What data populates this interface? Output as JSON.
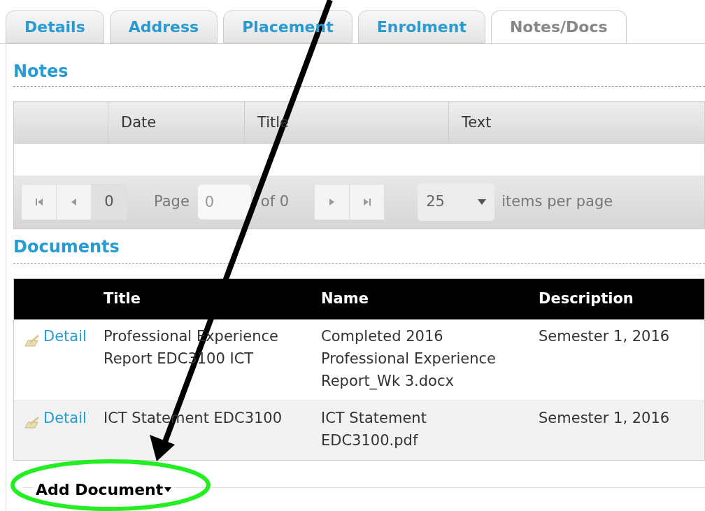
{
  "tabs": [
    {
      "label": "Details",
      "selected": false
    },
    {
      "label": "Address",
      "selected": false
    },
    {
      "label": "Placement",
      "selected": false
    },
    {
      "label": "Enrolment",
      "selected": false
    },
    {
      "label": "Notes/Docs",
      "selected": true
    }
  ],
  "notes": {
    "heading": "Notes",
    "columns": [
      "Date",
      "Title",
      "Text"
    ],
    "pager": {
      "current_page": "0",
      "page_label": "Page",
      "page_input": "0",
      "of_label": "of 0",
      "page_size": "25",
      "size_label": "items per page"
    }
  },
  "documents": {
    "heading": "Documents",
    "columns": [
      "Title",
      "Name",
      "Description"
    ],
    "rows": [
      {
        "link": "Detail",
        "title": "Professional Experience Report EDC3100 ICT",
        "name": "Completed 2016 Professional Experience Report_Wk 3.docx",
        "description": "Semester 1, 2016"
      },
      {
        "link": "Detail",
        "title": "ICT Statement EDC3100",
        "name": "ICT Statement EDC3100.pdf",
        "description": "Semester 1, 2016"
      }
    ]
  },
  "add_document": {
    "label": "Add Document",
    "expanded": false
  }
}
